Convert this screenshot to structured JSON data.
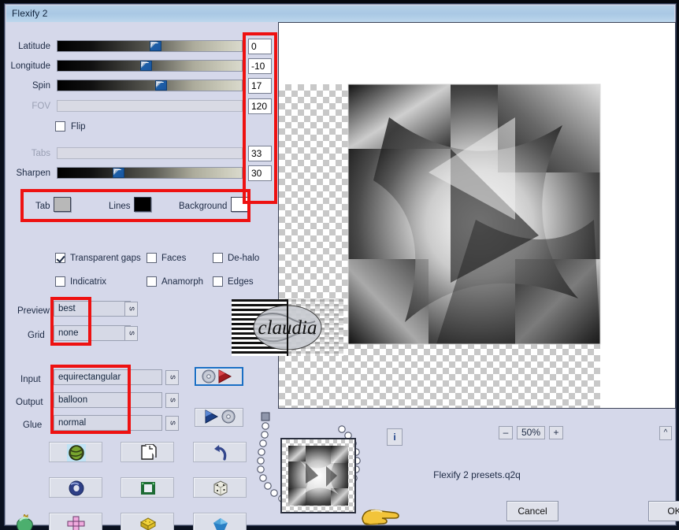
{
  "window": {
    "title": "Flexify 2"
  },
  "sliders": [
    {
      "label": "Latitude",
      "value": "0",
      "pos": 50,
      "disabled": false
    },
    {
      "label": "Longitude",
      "value": "-10",
      "pos": 45,
      "disabled": false
    },
    {
      "label": "Spin",
      "value": "17",
      "pos": 53,
      "disabled": false
    },
    {
      "label": "FOV",
      "value": "120",
      "pos": 0,
      "disabled": true
    },
    {
      "label": "Tabs",
      "value": "33",
      "pos": 0,
      "disabled": true
    },
    {
      "label": "Sharpen",
      "value": "30",
      "pos": 30,
      "disabled": false
    }
  ],
  "flip": {
    "label": "Flip",
    "checked": false
  },
  "colors": {
    "tab": {
      "label": "Tab",
      "value": "#b8b8b8"
    },
    "lines": {
      "label": "Lines",
      "value": "#000000"
    },
    "background": {
      "label": "Background",
      "value": "#ffffff"
    }
  },
  "checkboxes": [
    {
      "label": "Transparent gaps",
      "checked": true
    },
    {
      "label": "Faces",
      "checked": false
    },
    {
      "label": "De-halo",
      "checked": false
    },
    {
      "label": "Indicatrix",
      "checked": false
    },
    {
      "label": "Anamorph",
      "checked": false
    },
    {
      "label": "Edges",
      "checked": false
    }
  ],
  "selects": [
    {
      "label": "Preview",
      "value": "best",
      "side_button": "s"
    },
    {
      "label": "Grid",
      "value": "none",
      "side_button": "s"
    },
    {
      "label": "Input",
      "value": "equirectangular",
      "side_button": "s"
    },
    {
      "label": "Output",
      "value": "balloon",
      "side_button": "s"
    },
    {
      "label": "Glue",
      "value": "normal",
      "side_button": "s"
    }
  ],
  "preset_buttons": {
    "load_icon": "cd-red-play-icon",
    "save_icon": "blue-play-cd-icon"
  },
  "grid_buttons": [
    {
      "icon": "globe-photo-icon"
    },
    {
      "icon": "pages-copy-icon"
    },
    {
      "icon": "undo-arrow-icon"
    },
    {
      "icon": "blue-torus-icon"
    },
    {
      "icon": "green-square-frame-icon"
    },
    {
      "icon": "dice-icon"
    },
    {
      "icon": "pink-cross-icon"
    },
    {
      "icon": "yellow-cube-icon"
    },
    {
      "icon": "blue-gem-icon"
    }
  ],
  "corner_icon": "green-bulb-icon",
  "zoom": {
    "minus": "–",
    "level": "50%",
    "plus": "+"
  },
  "info_button": {
    "icon": "info-icon",
    "label": "i"
  },
  "collapse_button": {
    "icon": "chevron-up-icon",
    "label": "^"
  },
  "status_text": "Flexify 2 presets.q2q",
  "actions": {
    "cancel": "Cancel",
    "ok": "OK"
  },
  "cursor": {
    "icon": "pointing-hand-cursor"
  },
  "watermark": {
    "text": "claudia"
  },
  "annotations": {
    "color": "#ee1111",
    "boxes": [
      "numeric-value-column",
      "tab-lines-background-row",
      "preview-grid-selects",
      "input-output-glue-selects"
    ]
  }
}
